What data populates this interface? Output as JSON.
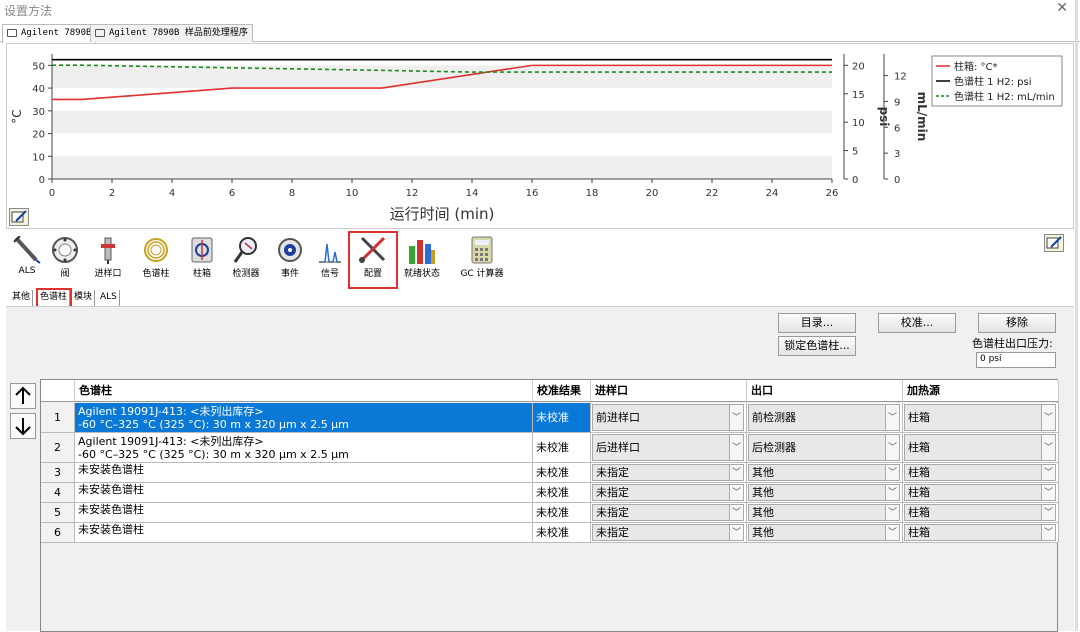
{
  "window": {
    "title": "设置方法",
    "close": "✕"
  },
  "tabs": [
    {
      "label": "Agilent 7890B"
    },
    {
      "label": "Agilent 7890B 样品前处理程序"
    }
  ],
  "chart_data": {
    "type": "line",
    "xlabel": "运行时间 (min)",
    "x_ticks": [
      0,
      2,
      4,
      6,
      8,
      10,
      12,
      14,
      16,
      18,
      20,
      22,
      24,
      26
    ],
    "xlim": [
      0,
      26
    ],
    "y_axes": [
      {
        "label": "°C",
        "ticks": [
          0,
          10,
          20,
          30,
          40,
          50
        ],
        "range": [
          0,
          55
        ]
      },
      {
        "label": "psi",
        "ticks": [
          0,
          5,
          10,
          15,
          20
        ],
        "range": [
          0,
          22
        ]
      },
      {
        "label": "mL/min",
        "ticks": [
          0,
          3,
          6,
          9,
          12
        ],
        "range": [
          0,
          14.5
        ]
      }
    ],
    "series": [
      {
        "name": "柱箱: °C*",
        "color": "#e03030",
        "axis": 0,
        "style": "solid",
        "x": [
          0,
          1,
          6,
          11,
          16,
          26
        ],
        "y": [
          35,
          35,
          40,
          40,
          50,
          50
        ]
      },
      {
        "name": "色谱柱 1 H2: psi",
        "color": "#000000",
        "axis": 1,
        "style": "solid",
        "x": [
          0,
          26
        ],
        "y": [
          21,
          21
        ]
      },
      {
        "name": "色谱柱 1 H2: mL/min",
        "color": "#1f8a1f",
        "axis": 2,
        "style": "dashed",
        "x": [
          0,
          1,
          6,
          11,
          14,
          16,
          26
        ],
        "y": [
          13.2,
          13.2,
          12.9,
          12.6,
          12.4,
          12.4,
          12.4
        ]
      }
    ],
    "legend": "right"
  },
  "toolbar": {
    "items": [
      {
        "label": "ALS",
        "icon": "syringe-icon"
      },
      {
        "label": "阀",
        "icon": "valve-icon"
      },
      {
        "label": "进样口",
        "icon": "inlet-icon"
      },
      {
        "label": "色谱柱",
        "icon": "column-coil-icon"
      },
      {
        "label": "柱箱",
        "icon": "oven-icon"
      },
      {
        "label": "检测器",
        "icon": "detector-icon"
      },
      {
        "label": "事件",
        "icon": "events-icon"
      },
      {
        "label": "信号",
        "icon": "signal-icon"
      },
      {
        "label": "配置",
        "icon": "config-tools-icon"
      },
      {
        "label": "就绪状态",
        "icon": "ready-state-icon"
      },
      {
        "label": "GC 计算器",
        "icon": "calculator-icon"
      }
    ]
  },
  "subtabs": [
    {
      "label": "其他"
    },
    {
      "label": "色谱柱"
    },
    {
      "label": "模块"
    },
    {
      "label": "ALS"
    }
  ],
  "buttons": {
    "catalog": "目录...",
    "calibrate": "校准...",
    "remove": "移除",
    "lock": "锁定色谱柱..."
  },
  "pressure": {
    "label": "色谱柱出口压力:",
    "value": "0 psi"
  },
  "grid": {
    "headers": [
      "色谱柱",
      "校准结果",
      "进样口",
      "出口",
      "加热源"
    ],
    "rows": [
      {
        "num": "1",
        "col": "Agilent 19091J-413:  <未列出库存>",
        "col2": "-60 °C–325 °C (325 °C): 30 m x 320 μm x 2.5 μm",
        "cal": "未校准",
        "inlet": "前进样口",
        "outlet": "前检测器",
        "heat": "柱箱"
      },
      {
        "num": "2",
        "col": "Agilent 19091J-413:  <未列出库存>",
        "col2": "-60 °C–325 °C (325 °C): 30 m x 320 μm x 2.5 μm",
        "cal": "未校准",
        "inlet": "后进样口",
        "outlet": "后检测器",
        "heat": "柱箱"
      },
      {
        "num": "3",
        "col": "未安装色谱柱",
        "col2": "",
        "cal": "未校准",
        "inlet": "未指定",
        "outlet": "其他",
        "heat": "柱箱"
      },
      {
        "num": "4",
        "col": "未安装色谱柱",
        "col2": "",
        "cal": "未校准",
        "inlet": "未指定",
        "outlet": "其他",
        "heat": "柱箱"
      },
      {
        "num": "5",
        "col": "未安装色谱柱",
        "col2": "",
        "cal": "未校准",
        "inlet": "未指定",
        "outlet": "其他",
        "heat": "柱箱"
      },
      {
        "num": "6",
        "col": "未安装色谱柱",
        "col2": "",
        "cal": "未校准",
        "inlet": "未指定",
        "outlet": "其他",
        "heat": "柱箱"
      }
    ]
  }
}
